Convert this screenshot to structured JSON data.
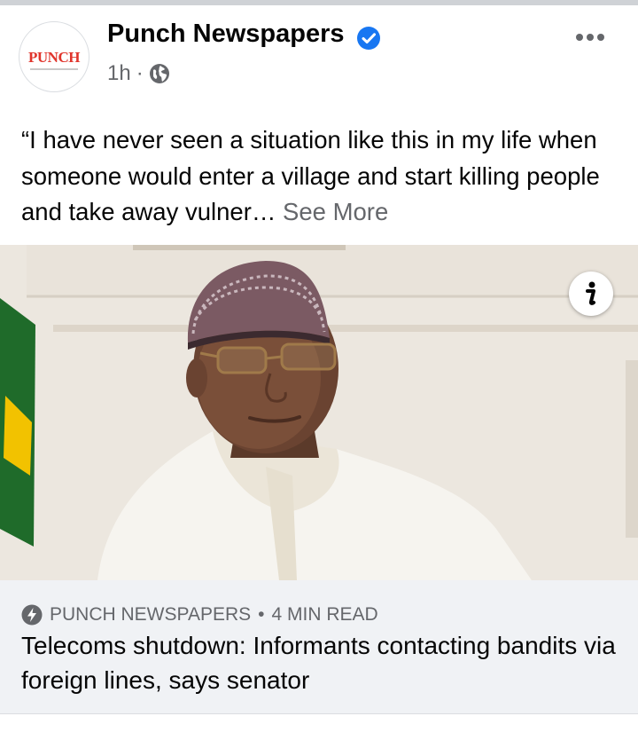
{
  "post": {
    "page_name": "Punch Newspapers",
    "avatar_logo_text": "PUNCH",
    "time": "1h",
    "separator": "·",
    "audience_icon": "globe-icon",
    "verified_icon": "verified-badge-icon",
    "menu_icon": "more-options-icon",
    "text": "“I have never seen a situation like this in my life when someone would enter a village and start killing people and take away vulner…",
    "see_more_label": "See More"
  },
  "photo": {
    "info_icon": "info-icon"
  },
  "link_preview": {
    "source_icon": "instant-article-bolt-icon",
    "source": "PUNCH NEWSPAPERS",
    "separator": "•",
    "read_time": "4 MIN READ",
    "title": "Telecoms shutdown: Informants contacting bandits via foreign lines, says senator"
  },
  "colors": {
    "verified_blue": "#1877f2",
    "text_primary": "#050505",
    "text_secondary": "#65676b",
    "card_background": "#f0f2f5",
    "logo_red": "#e0342b"
  }
}
